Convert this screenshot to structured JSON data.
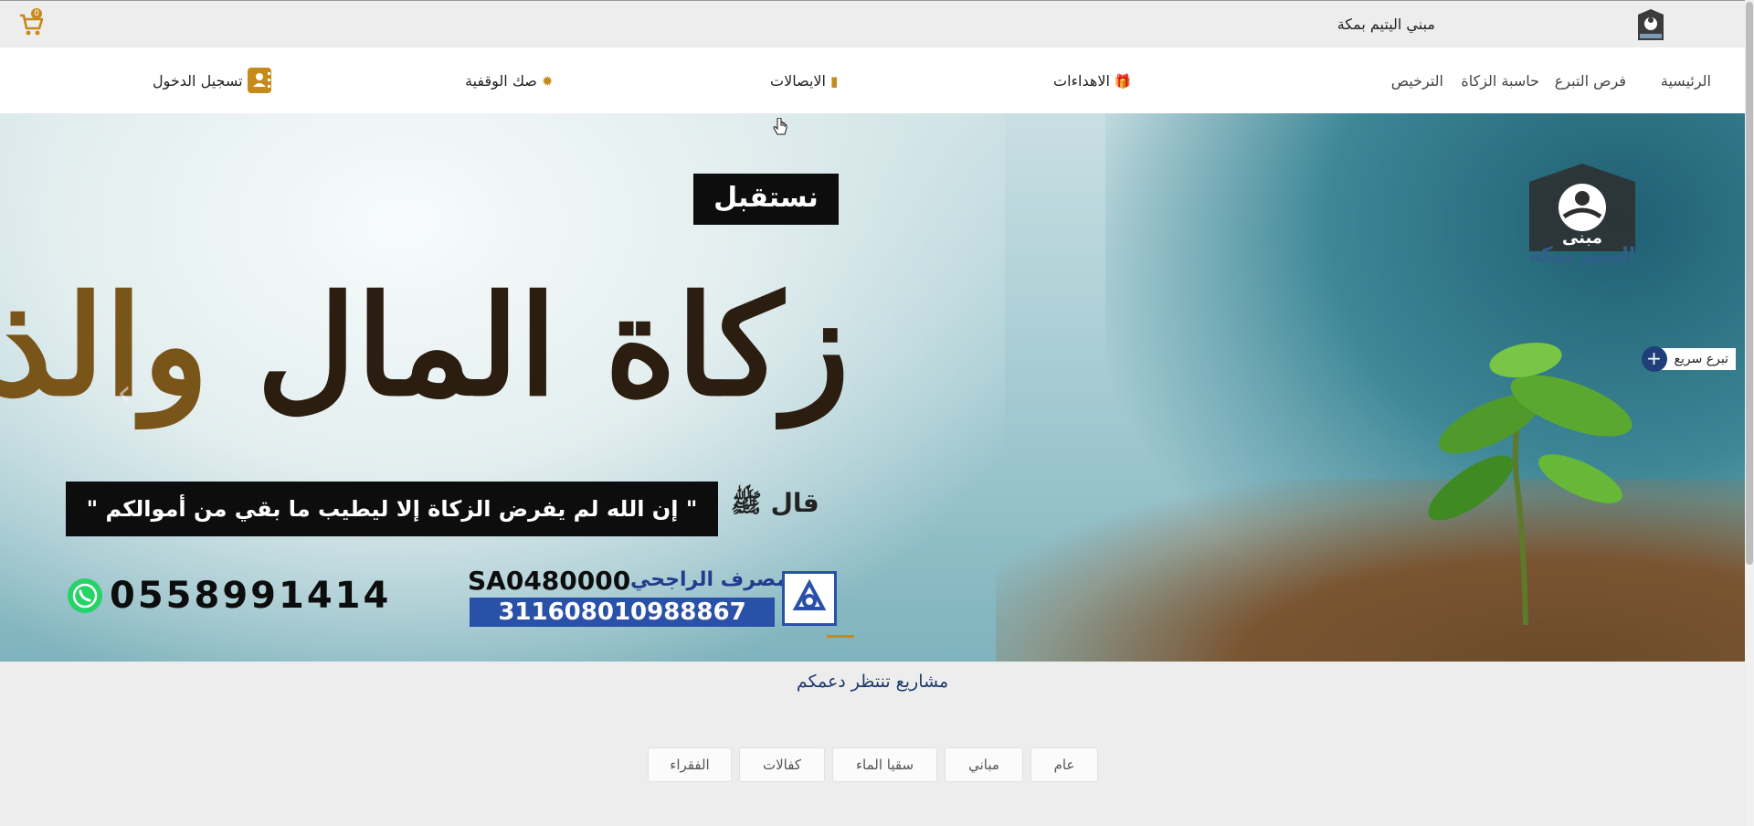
{
  "header": {
    "site_name": "مبني اليتيم بمكة",
    "cart_count": "0"
  },
  "nav": {
    "links": [
      "الرئيسية",
      "فرص التبرع",
      "حاسبة الزكاة",
      "الترخيص"
    ],
    "gifts": "الاهداءات",
    "receipts": "الايصالات",
    "waqf": "صك الوقفية",
    "login": "تسجيل الدخول"
  },
  "hero": {
    "badge": "نستقبل",
    "headline_1": "زكاة المال",
    "headline_2": "والذهب",
    "quote_prefix": "قال ﷺ",
    "quote": "\" إن الله لم يفرض الزكاة إلا ليطيب ما بقي من أموالكم \"",
    "phone": "0558991414",
    "bank_name": "مصرف الراجحي",
    "iban_line1": "SA0480000",
    "iban_line2": "311608010988867",
    "logo_line1": "مبنى",
    "logo_line2": "اليتيم بمكة"
  },
  "quick_donate": {
    "label": "تبرع سريع",
    "plus": "+"
  },
  "projects": {
    "title": "مشاريع تنتظر دعمكم",
    "filters": [
      "عام",
      "مباني",
      "سقيا الماء",
      "كفالات",
      "الفقراء"
    ]
  },
  "colors": {
    "accent": "#c58a1a",
    "navy": "#1d3a6b"
  }
}
